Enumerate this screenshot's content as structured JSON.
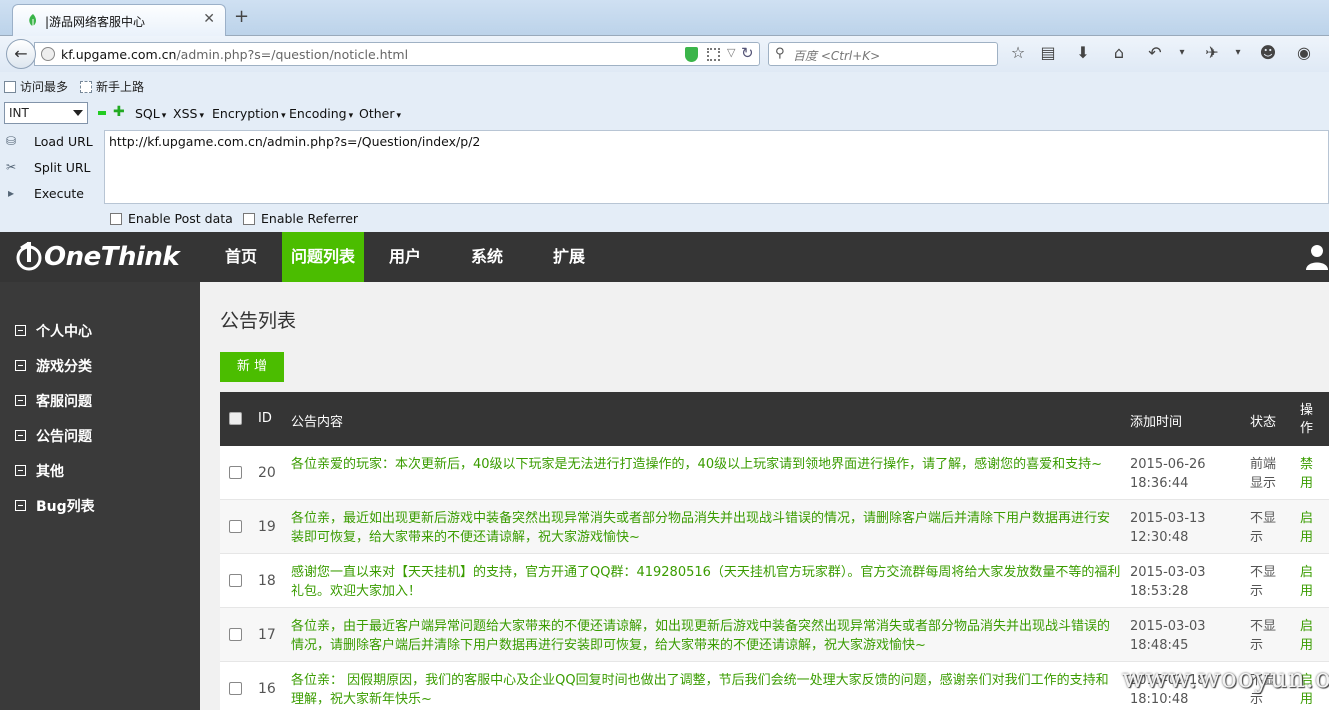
{
  "browser": {
    "tab_title": "|游品网络客服中心",
    "url_domain": "kf.upgame.com.cn",
    "url_path": "/admin.php?s=/question/noticle.html",
    "search_placeholder": "百度 <Ctrl+K>"
  },
  "bookmarks": [
    "访问最多",
    "新手上路"
  ],
  "hackbar": {
    "select_value": "INT",
    "menus": [
      "SQL",
      "XSS",
      "Encryption",
      "Encoding",
      "Other"
    ],
    "actions": [
      "Load URL",
      "Split URL",
      "Execute"
    ],
    "url_value": "http://kf.upgame.com.cn/admin.php?s=/Question/index/p/2",
    "checks": [
      "Enable Post data",
      "Enable Referrer"
    ]
  },
  "app": {
    "logo_text": "OneThink",
    "nav": [
      "首页",
      "问题列表",
      "用户",
      "系统",
      "扩展"
    ],
    "nav_active_index": 1,
    "sidebar": [
      "个人中心",
      "游戏分类",
      "客服问题",
      "公告问题",
      "其他",
      "Bug列表"
    ],
    "page_title": "公告列表",
    "add_button": "新 增",
    "accent_color": "#4bbd00",
    "table": {
      "columns": [
        "ID",
        "公告内容",
        "添加时间",
        "状态",
        "操作"
      ],
      "rows": [
        {
          "id": "20",
          "content": "各位亲爱的玩家：本次更新后，40级以下玩家是无法进行打造操作的，40级以上玩家请到领地界面进行操作，请了解，感谢您的喜爱和支持~",
          "time": "2015-06-26 18:36:44",
          "status": "前端显示",
          "op": "禁用"
        },
        {
          "id": "19",
          "content": "各位亲，最近如出现更新后游戏中装备突然出现异常消失或者部分物品消失并出现战斗错误的情况，请删除客户端后并清除下用户数据再进行安装即可恢复，给大家带来的不便还请谅解，祝大家游戏愉快~",
          "time": "2015-03-13 12:30:48",
          "status": "不显示",
          "op": "启用"
        },
        {
          "id": "18",
          "content": "感谢您一直以来对【天天挂机】的支持，官方开通了QQ群：419280516（天天挂机官方玩家群）。官方交流群每周将给大家发放数量不等的福利礼包。欢迎大家加入！",
          "time": "2015-03-03 18:53:28",
          "status": "不显示",
          "op": "启用"
        },
        {
          "id": "17",
          "content": "各位亲，由于最近客户端异常问题给大家带来的不便还请谅解，如出现更新后游戏中装备突然出现异常消失或者部分物品消失并出现战斗错误的情况，请删除客户端后并清除下用户数据再进行安装即可恢复，给大家带来的不便还请谅解，祝大家游戏愉快~",
          "time": "2015-03-03 18:48:45",
          "status": "不显示",
          "op": "启用"
        },
        {
          "id": "16",
          "content": "各位亲： 因假期原因，我们的客服中心及企业QQ回复时间也做出了调整，节后我们会统一处理大家反馈的问题，感谢亲们对我们工作的支持和理解，祝大家新年快乐~",
          "time": "2015-02-18 18:10:48",
          "status": "不显示",
          "op": "启用"
        }
      ]
    }
  },
  "watermark": "www.wooyun.org"
}
